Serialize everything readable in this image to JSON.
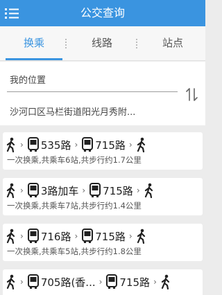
{
  "header": {
    "title": "公交查询",
    "menu_icon": "menu-icon"
  },
  "tabs": [
    {
      "label": "换乘",
      "active": true
    },
    {
      "label": "线路",
      "active": false
    },
    {
      "label": "站点",
      "active": false
    }
  ],
  "search": {
    "from": "我的位置",
    "to": "沙河口区马栏街道阳光月秀附...",
    "swap_icon": "swap-icon"
  },
  "colors": {
    "accent": "#3a94e0",
    "background": "#ececec"
  },
  "routes": [
    {
      "lines": [
        "535路",
        "715路"
      ],
      "summary": "一次换乘,共乘车6站,共步行约1.7公里"
    },
    {
      "lines": [
        "3路加车",
        "715路"
      ],
      "summary": "一次换乘,共乘车7站,共步行约1.4公里"
    },
    {
      "lines": [
        "716路",
        "715路"
      ],
      "summary": "一次换乘,共乘车5站,共步行约1.8公里"
    },
    {
      "lines": [
        "705路(香...",
        "715路"
      ],
      "summary": ""
    }
  ]
}
